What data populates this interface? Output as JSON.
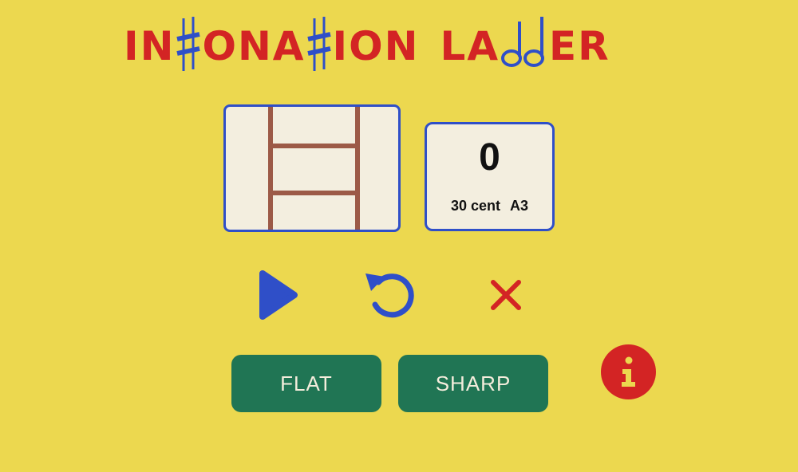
{
  "title": {
    "seg1": "IN",
    "sharp1": "sharp-glyph",
    "seg2": "ONA",
    "sharp2": "sharp-glyph",
    "seg3": "ION",
    "seg4": "LA",
    "notes": "note-glyphs",
    "seg5": "ER"
  },
  "colors": {
    "background": "#ecd84f",
    "title_red": "#d32424",
    "accent_blue": "#2f4fc8",
    "button_green": "#207554",
    "card_bg": "#f3eedf",
    "ladder_brown": "#9c5a47"
  },
  "score": {
    "value": "0",
    "cents": "30 cent",
    "note": "A3"
  },
  "controls": {
    "play_icon": "play-icon",
    "restart_icon": "restart-icon",
    "close_icon": "close-icon"
  },
  "buttons": {
    "flat_label": "FLAT",
    "sharp_label": "SHARP"
  },
  "info_icon": "info-icon"
}
